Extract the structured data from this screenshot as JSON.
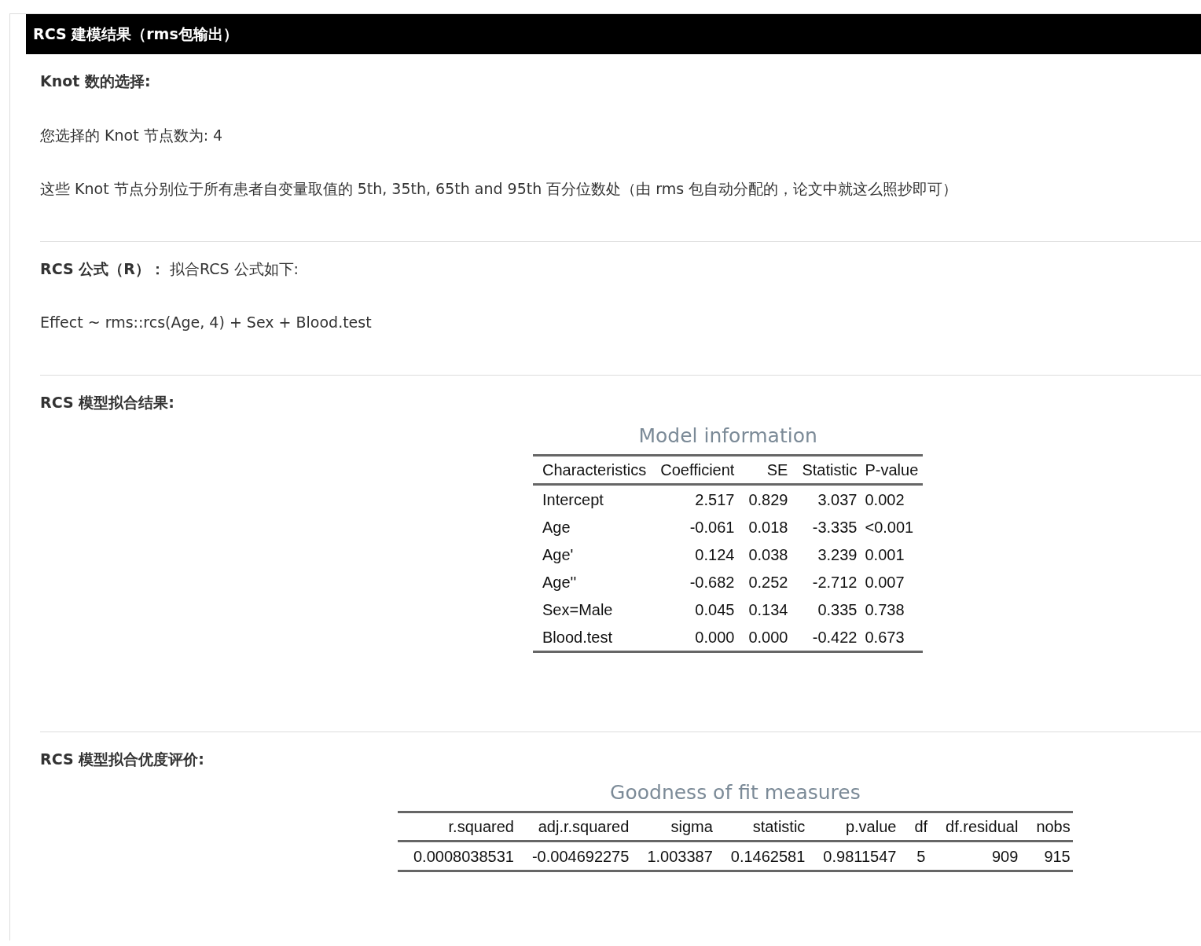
{
  "header": {
    "title": "RCS 建模结果（rms包输出）"
  },
  "sections": [
    {
      "heading": "Knot 数的选择:",
      "bold": true,
      "paragraphs": [
        "您选择的 Knot 节点数为: 4",
        "这些 Knot 节点分别位于所有患者自变量取值的 5th, 35th, 65th and 95th 百分位数处（由 rms 包自动分配的，论文中就这么照抄即可）"
      ]
    },
    {
      "heading": "**RCS 公式（R）：** 拟合RCS 公式如下:",
      "bold": false,
      "paragraphs": [
        "Effect ~ rms::rcs(Age, 4) + Sex + Blood.test"
      ]
    },
    {
      "heading": "RCS 模型拟合结果:",
      "bold": true,
      "table": {
        "caption": "Model information",
        "kind": "model",
        "columns": [
          "Characteristics",
          "Coefficient",
          "SE",
          "Statistic",
          "P-value"
        ],
        "rows": [
          [
            "Intercept",
            "2.517",
            "0.829",
            "3.037",
            "0.002"
          ],
          [
            "Age",
            "-0.061",
            "0.018",
            "-3.335",
            "<0.001"
          ],
          [
            "Age'",
            "0.124",
            "0.038",
            "3.239",
            "0.001"
          ],
          [
            "Age''",
            "-0.682",
            "0.252",
            "-2.712",
            "0.007"
          ],
          [
            "Sex=Male",
            "0.045",
            "0.134",
            "0.335",
            "0.738"
          ],
          [
            "Blood.test",
            "0.000",
            "0.000",
            "-0.422",
            "0.673"
          ]
        ]
      }
    },
    {
      "heading": "RCS 模型拟合优度评价:",
      "bold": true,
      "table": {
        "caption": "Goodness of fit measures",
        "kind": "fit",
        "columns": [
          "r.squared",
          "adj.r.squared",
          "sigma",
          "statistic",
          "p.value",
          "df",
          "df.residual",
          "nobs"
        ],
        "rows": [
          [
            "0.0008038531",
            "-0.004692275",
            "1.003387",
            "0.1462581",
            "0.9811547",
            "5",
            "909",
            "915"
          ]
        ]
      }
    }
  ]
}
